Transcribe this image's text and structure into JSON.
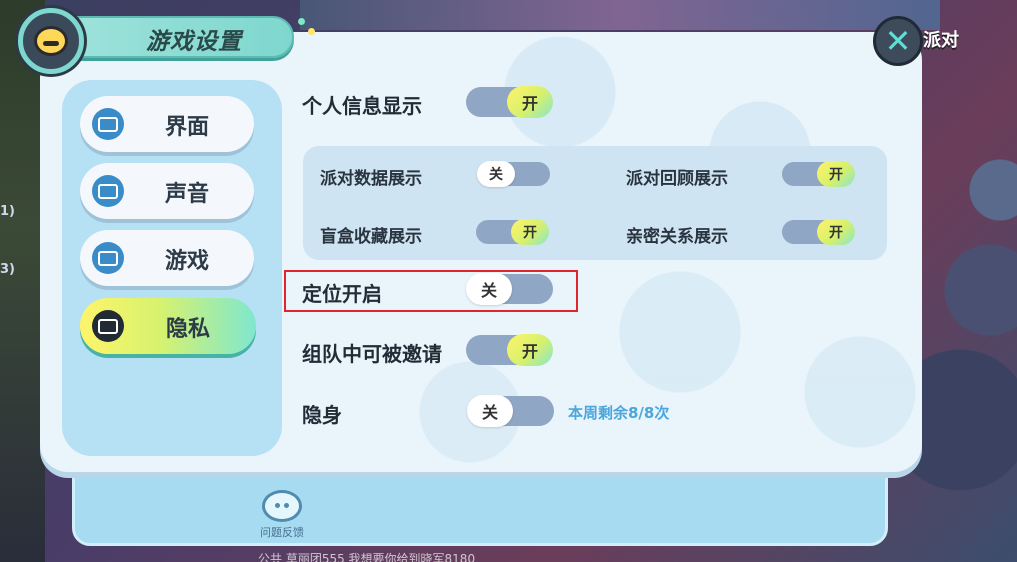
{
  "background": {
    "right_label": "派对",
    "left_nums": [
      "1)",
      "3)"
    ],
    "bottom_text": "公共  草丽团555 我想要你给到晓军8180"
  },
  "dialog": {
    "title": "游戏设置",
    "close_label": "✕",
    "feedback_label": "问题反馈"
  },
  "sidebar": {
    "items": [
      {
        "label": "界面",
        "active": false
      },
      {
        "label": "声音",
        "active": false
      },
      {
        "label": "游戏",
        "active": false
      },
      {
        "label": "隐私",
        "active": true
      }
    ]
  },
  "settings": {
    "personal_info": {
      "label": "个人信息显示",
      "state": "开"
    },
    "sub": {
      "party_data": {
        "label": "派对数据展示",
        "state": "关"
      },
      "party_review": {
        "label": "派对回顾展示",
        "state": "开"
      },
      "blindbox": {
        "label": "盲盒收藏展示",
        "state": "开"
      },
      "intimacy": {
        "label": "亲密关系展示",
        "state": "开"
      }
    },
    "location": {
      "label": "定位开启",
      "state": "关"
    },
    "team_invite": {
      "label": "组队中可被邀请",
      "state": "开"
    },
    "invisible": {
      "label": "隐身",
      "state": "关",
      "note": "本周剩余8/8次"
    }
  },
  "colors": {
    "accent_on": "#d6f06c",
    "highlight": "#e0262a",
    "note": "#4aa6dc"
  }
}
